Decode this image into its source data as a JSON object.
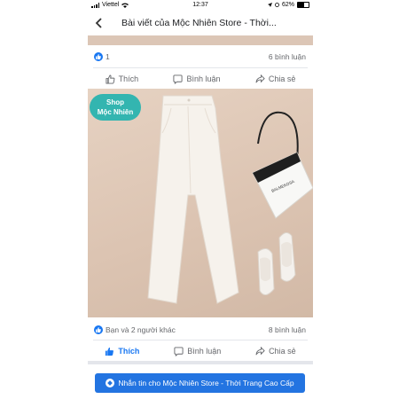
{
  "status": {
    "carrier": "Viettel",
    "time": "12:37",
    "battery": "62%",
    "battery_level": 0.62
  },
  "header": {
    "title": "Bài viết của Mộc Nhiên Store - Thời..."
  },
  "post1": {
    "reaction_count": "1",
    "comments": "6 bình luận"
  },
  "actions1": {
    "like": "Thích",
    "comment": "Bình luận",
    "share": "Chia sẻ"
  },
  "photo": {
    "badge_line1": "Shop",
    "badge_line2": "Mộc Nhiên",
    "bag_text": "BALMEKOSA"
  },
  "post2": {
    "reactions": "Bạn và 2 người khác",
    "comments": "8 bình luận"
  },
  "actions2": {
    "like": "Thích",
    "comment": "Bình luận",
    "share": "Chia sẻ"
  },
  "cta": {
    "label": "Nhắn tin cho Mộc Nhiên Store - Thời Trang Cao Cấp"
  },
  "colors": {
    "accent": "#1877f2",
    "cta": "#2374e1",
    "badge": "#33b5b0",
    "photo_bg": "#dcc4b2"
  }
}
